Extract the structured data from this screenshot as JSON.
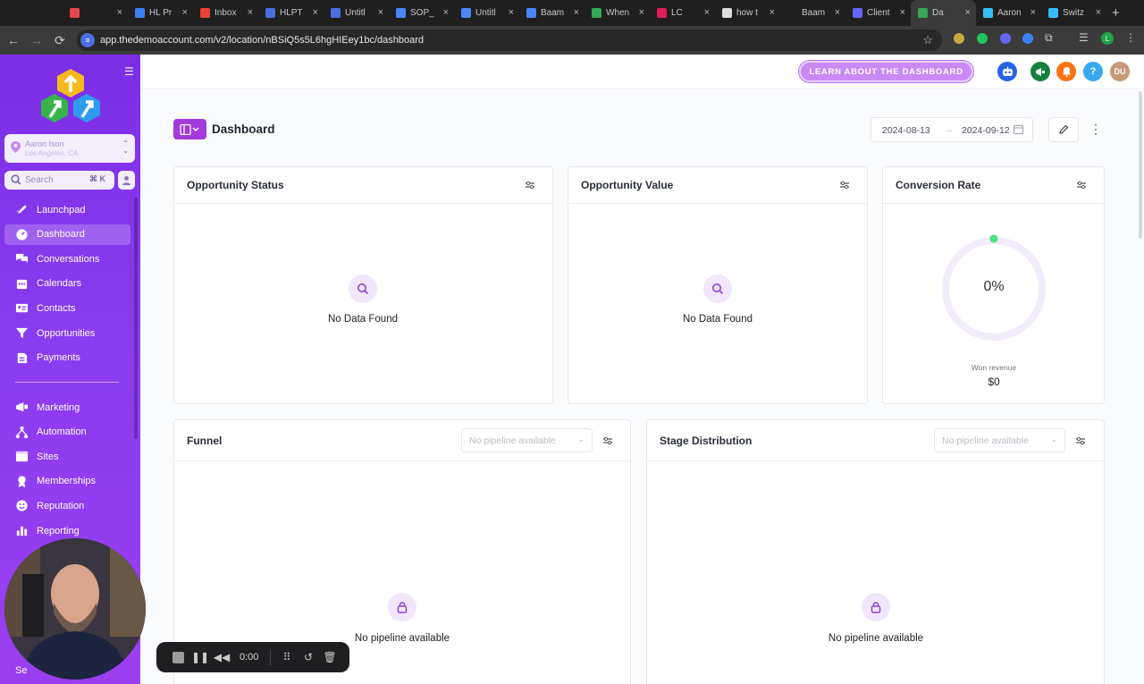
{
  "browser": {
    "tabs": [
      {
        "title": "",
        "icon": "recording-icon",
        "color": "#e5484d"
      },
      {
        "title": "HL Pr",
        "icon": "lightning-icon",
        "color": "#3b82f6"
      },
      {
        "title": "Inbox",
        "icon": "gmail-icon",
        "color": "#ea4335"
      },
      {
        "title": "HLPT",
        "icon": "globe-icon",
        "color": "#4a6ee0"
      },
      {
        "title": "Untitl",
        "icon": "globe-icon",
        "color": "#4a6ee0"
      },
      {
        "title": "SOP_",
        "icon": "docs-icon",
        "color": "#4a86f7"
      },
      {
        "title": "Untitl",
        "icon": "docs-icon",
        "color": "#4a86f7"
      },
      {
        "title": "Baam",
        "icon": "slides-icon",
        "color": "#4a86f7"
      },
      {
        "title": "When",
        "icon": "sheets-icon",
        "color": "#34a853"
      },
      {
        "title": "LC",
        "icon": "feather-icon",
        "color": "#e01e5a"
      },
      {
        "title": "how t",
        "icon": "google-icon",
        "color": "#dddddd"
      },
      {
        "title": "Baam",
        "icon": "b-icon",
        "color": "#1f1f1f"
      },
      {
        "title": "Client",
        "icon": "gear-icon",
        "color": "#6366f1"
      },
      {
        "title": "Da",
        "icon": "app-icon",
        "color": "#34a853"
      },
      {
        "title": "Aaron",
        "icon": "diamond-icon",
        "color": "#38bdf8"
      },
      {
        "title": "Switz",
        "icon": "diamond-icon",
        "color": "#38bdf8"
      }
    ],
    "active_tab_index": 13,
    "new_tab": "+",
    "url": "app.thedemoaccount.com/v2/location/nBSiQ5s5L6hgHIEey1bc/dashboard",
    "profile_letter": "L"
  },
  "sidebar": {
    "account": {
      "name": "Aaron Ison",
      "location": "Los Angeles, CA"
    },
    "search": {
      "placeholder": "Search",
      "shortcut": "⌘ K"
    },
    "items": [
      {
        "label": "Launchpad",
        "icon": "rocket-icon"
      },
      {
        "label": "Dashboard",
        "icon": "gauge-icon",
        "active": true
      },
      {
        "label": "Conversations",
        "icon": "chat-icon"
      },
      {
        "label": "Calendars",
        "icon": "calendar-icon"
      },
      {
        "label": "Contacts",
        "icon": "contact-card-icon"
      },
      {
        "label": "Opportunities",
        "icon": "filter-funnel-icon"
      },
      {
        "label": "Payments",
        "icon": "payments-icon"
      }
    ],
    "items2": [
      {
        "label": "Marketing",
        "icon": "megaphone-icon"
      },
      {
        "label": "Automation",
        "icon": "automation-icon"
      },
      {
        "label": "Sites",
        "icon": "sites-icon"
      },
      {
        "label": "Memberships",
        "icon": "membership-icon"
      },
      {
        "label": "Reputation",
        "icon": "smile-icon"
      },
      {
        "label": "Reporting",
        "icon": "bar-chart-icon"
      }
    ],
    "settings_peek": "Se"
  },
  "header": {
    "learn_button": "LEARN ABOUT THE DASHBOARD",
    "avatar_initials": "DU",
    "help": "?"
  },
  "page": {
    "title": "Dashboard",
    "date_start": "2024-08-13",
    "date_end": "2024-09-12"
  },
  "cards": {
    "opportunity_status": {
      "title": "Opportunity Status",
      "empty": "No Data Found"
    },
    "opportunity_value": {
      "title": "Opportunity Value",
      "empty": "No Data Found"
    },
    "conversion_rate": {
      "title": "Conversion Rate",
      "value": "0%",
      "won_label": "Won revenue",
      "won_value": "$0"
    },
    "funnel": {
      "title": "Funnel",
      "select_placeholder": "No pipeline available",
      "empty": "No pipeline available"
    },
    "stage_distribution": {
      "title": "Stage Distribution",
      "select_placeholder": "No pipeline available",
      "empty": "No pipeline available"
    }
  },
  "recorder": {
    "time": "0:00"
  },
  "colors": {
    "sidebar": "#8a3cf0",
    "accent": "#a43ad9",
    "learn_button": "#c98af5",
    "gauge_dot": "#4ade80"
  }
}
